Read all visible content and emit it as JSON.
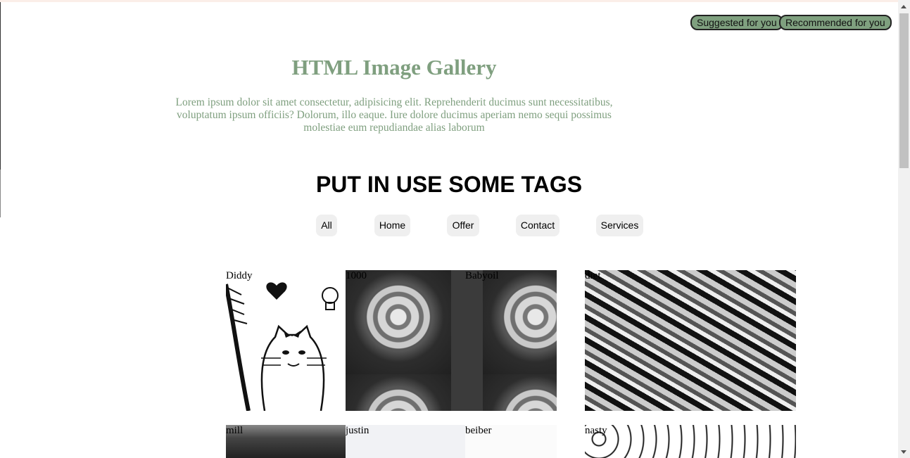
{
  "header": {
    "suggested_label": "Suggested for you",
    "recommended_label": "Recommended for you"
  },
  "hero": {
    "title": "HTML Image Gallery",
    "intro": "Lorem ipsum dolor sit amet consectetur, adipisicing elit. Reprehenderit ducimus sunt necessitatibus, voluptatum ipsum officiis? Dolorum, illo eaque. Iure dolore ducimus aperiam nemo sequi possimus molestiae eum repudiandae alias laborum"
  },
  "tags": {
    "heading": "PUT IN USE SOME TAGS",
    "items": [
      "All",
      "Home",
      "Offer",
      "Contact",
      "Services"
    ]
  },
  "gallery": {
    "row1": [
      "Diddy",
      "1000",
      "Babyoil",
      "diet"
    ],
    "row2": [
      "mill",
      "justin",
      "beiber",
      "nasty"
    ]
  },
  "colors": {
    "accent": "#7f9f7f",
    "pill_bg": "#7fa07f"
  }
}
